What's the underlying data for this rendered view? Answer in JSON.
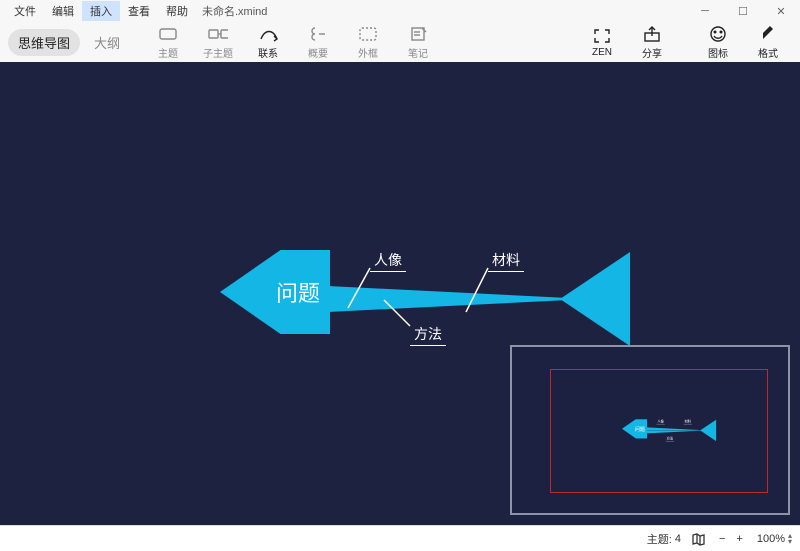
{
  "menu": {
    "file": "文件",
    "edit": "编辑",
    "insert": "插入",
    "view": "查看",
    "help": "帮助"
  },
  "doc_title": "未命名.xmind",
  "view_tabs": {
    "mindmap": "思维导图",
    "outline": "大纲"
  },
  "tools": {
    "topic": "主题",
    "subtopic": "子主题",
    "relation": "联系",
    "summary": "概要",
    "boundary": "外框",
    "note": "笔记",
    "zen": "ZEN",
    "share": "分享",
    "icons": "图标",
    "format": "格式"
  },
  "diagram": {
    "center": "问题",
    "branches": {
      "up1": "人像",
      "up2": "材料",
      "down1": "方法"
    }
  },
  "status": {
    "topic_label": "主题:",
    "topic_count": "4",
    "zoom_pct": "100%",
    "minus": "−",
    "plus": "+"
  }
}
